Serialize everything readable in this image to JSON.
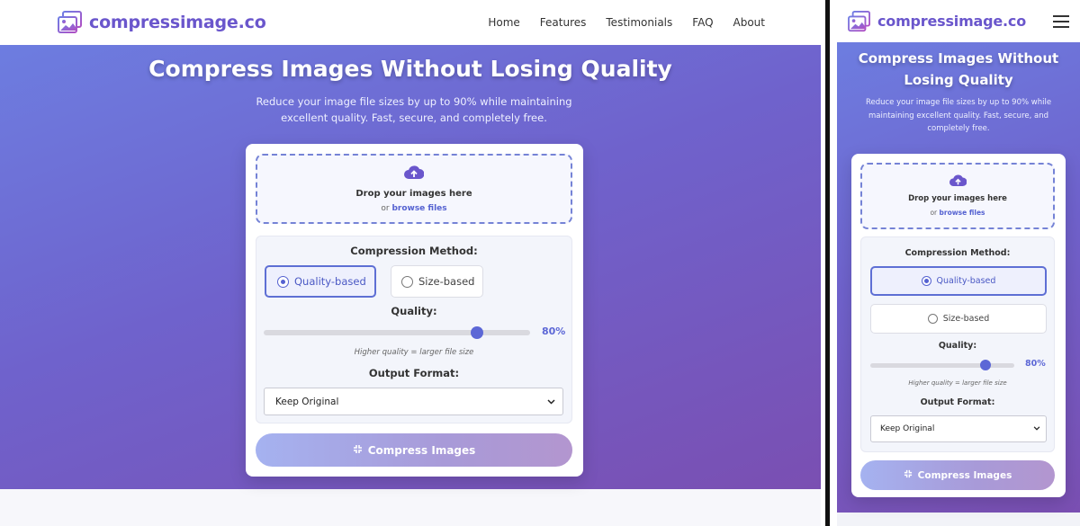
{
  "brand": {
    "name": "compressimage.co",
    "icon": "image-gallery-icon",
    "color": "#6a56cc"
  },
  "nav": {
    "links": [
      "Home",
      "Features",
      "Testimonials",
      "FAQ",
      "About"
    ],
    "menu_icon": "hamburger-menu-icon"
  },
  "hero": {
    "title": "Compress Images Without Losing Quality",
    "subtitle": "Reduce your image file sizes by up to 90% while maintaining excellent quality. Fast, secure, and completely free."
  },
  "upload": {
    "icon": "cloud-upload-icon",
    "title": "Drop your images here",
    "or_text": "or",
    "browse_link": "browse files"
  },
  "settings": {
    "method_label": "Compression Method:",
    "methods": [
      {
        "label": "Quality-based",
        "selected": true
      },
      {
        "label": "Size-based",
        "selected": false
      }
    ],
    "quality_label": "Quality:",
    "quality_value": 80,
    "quality_display": "80%",
    "quality_hint": "Higher quality = larger file size",
    "format_label": "Output Format:",
    "format_selected": "Keep Original"
  },
  "compress_button": {
    "label": "Compress Images",
    "icon": "compress-arrows-icon"
  },
  "colors": {
    "accent": "#5c67d6",
    "hero_start": "#6d7de0",
    "hero_end": "#7a4fb2"
  }
}
